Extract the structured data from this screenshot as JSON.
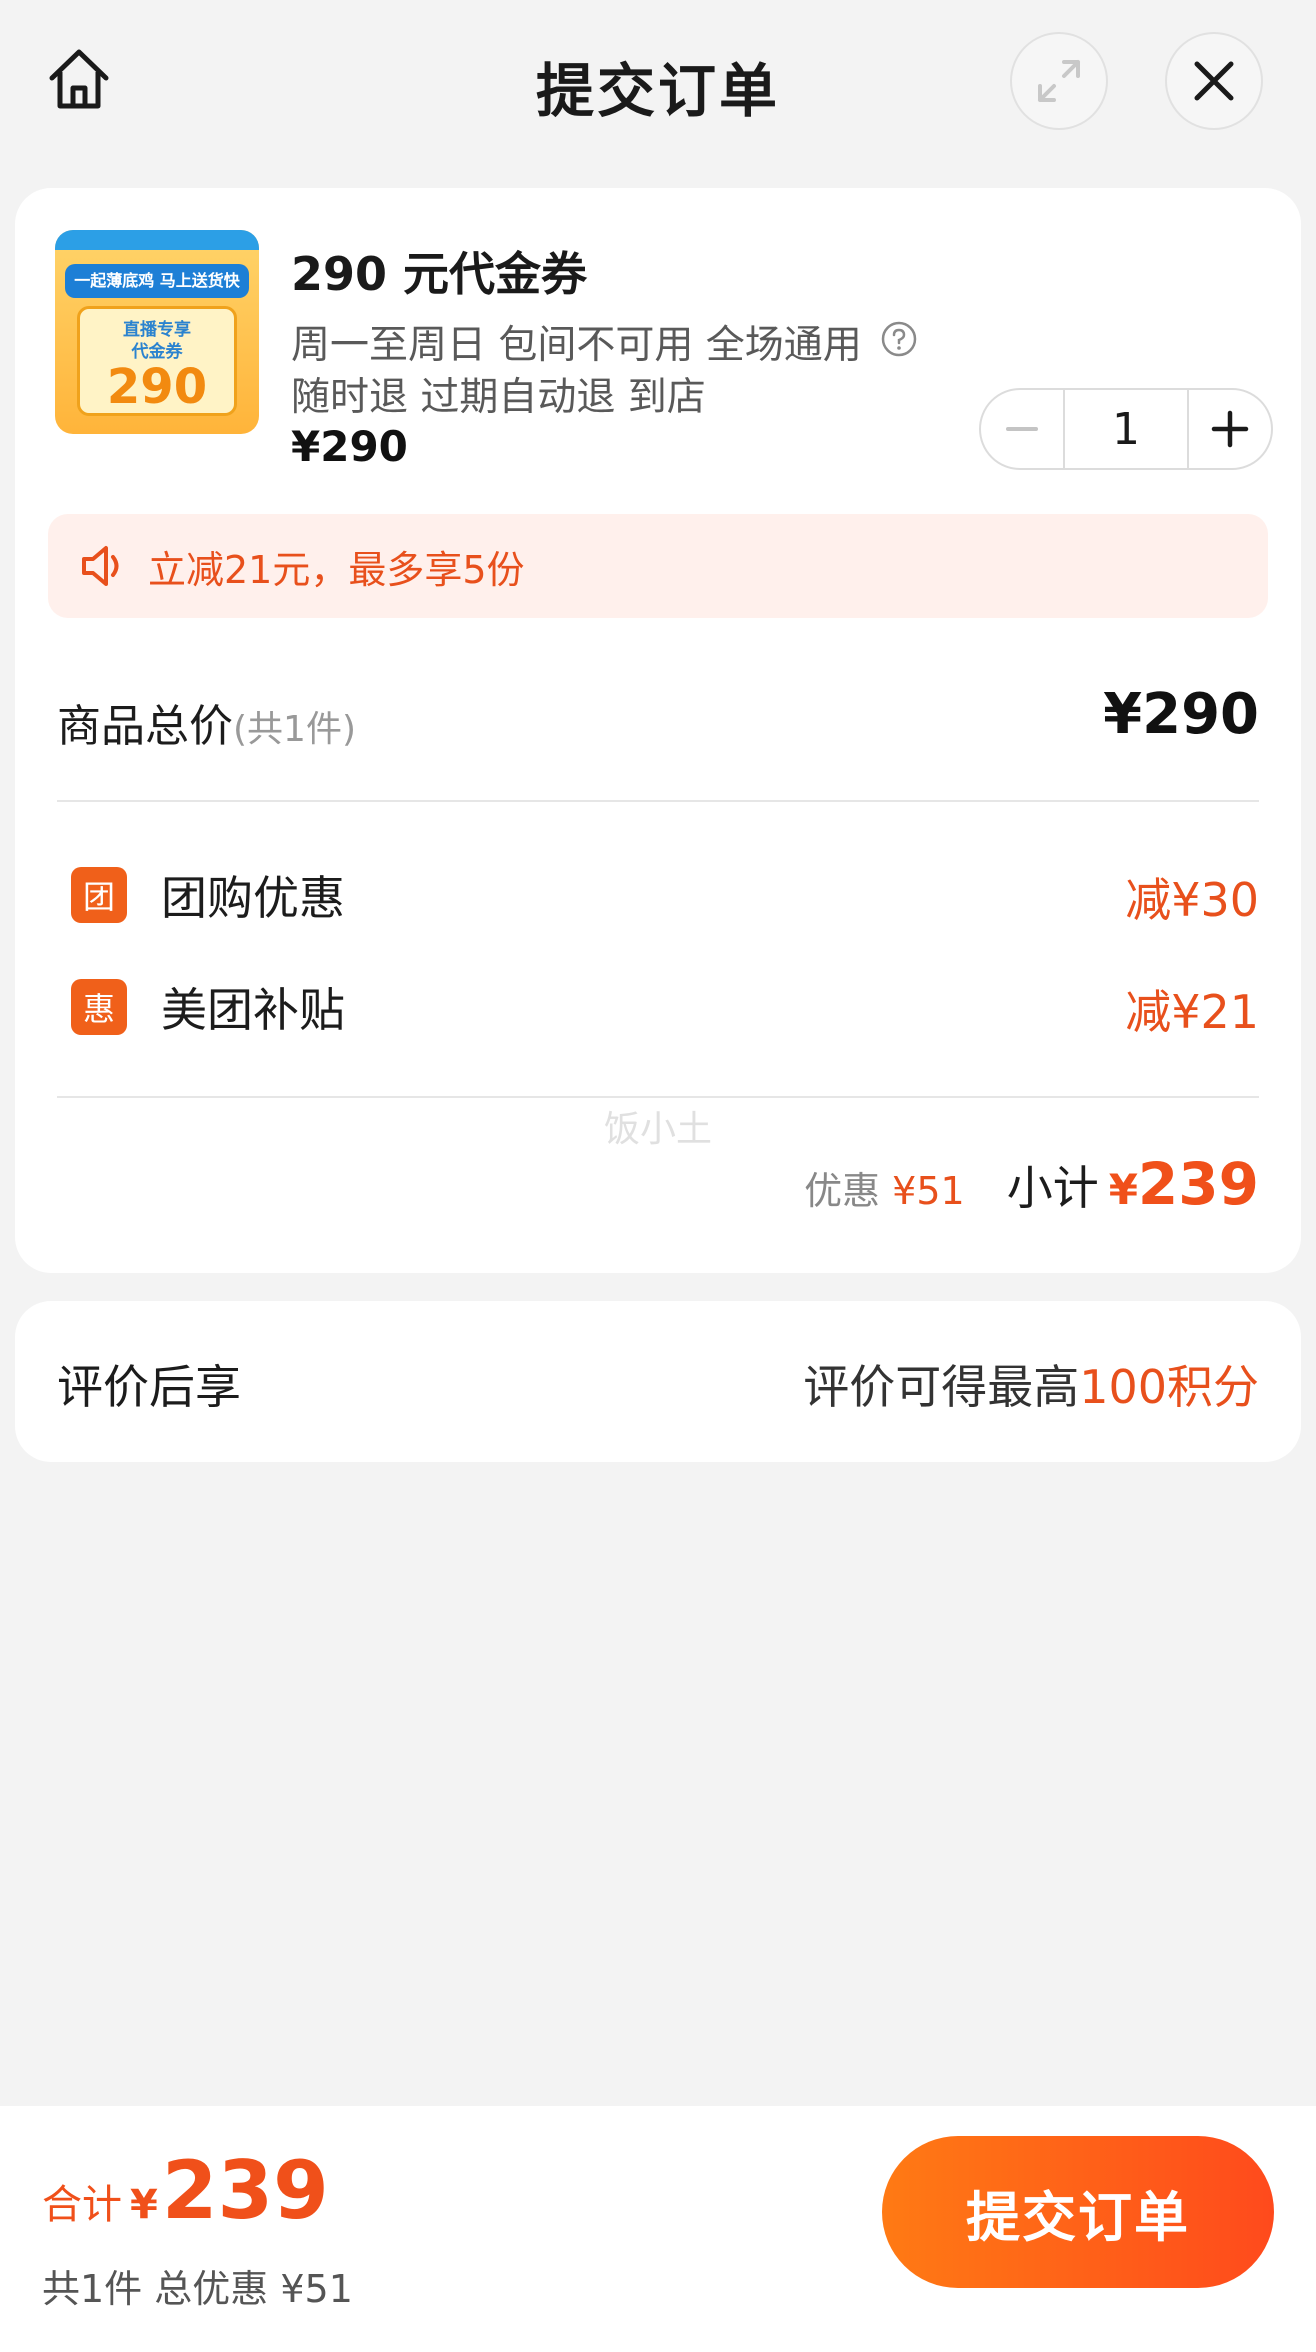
{
  "header": {
    "title": "提交订单",
    "home_icon": "home-icon",
    "expand_icon": "expand-icon",
    "close_icon": "close-icon"
  },
  "product": {
    "thumb": {
      "banner": "一起薄底鸡 马上送货快",
      "small_line1": "直播专享",
      "small_line2": "代金券",
      "amount": "290"
    },
    "title": "290 元代金券",
    "desc_line1": "周一至周日 包间不可用 全场通用",
    "desc_line2": "随时退 过期自动退 到店",
    "price": "¥290",
    "quantity": "1"
  },
  "promo": {
    "text": "立减21元，最多享5份",
    "icon": "speaker-icon"
  },
  "summary": {
    "total_label": "商品总价",
    "total_sub": "(共1件)",
    "total_value": "¥290",
    "discounts": [
      {
        "badge": "团",
        "label": "团购优惠",
        "value": "减¥30"
      },
      {
        "badge": "惠",
        "label": "美团补贴",
        "value": "减¥21"
      }
    ],
    "watermark": "饭小土",
    "discount_label": "优惠",
    "discount_value": "¥51",
    "subtotal_label": "小计",
    "subtotal_currency": "¥",
    "subtotal_value": "239"
  },
  "review": {
    "label": "评价后享",
    "value_prefix": "评价可得最高",
    "value_highlight": "100积分"
  },
  "bottom_bar": {
    "total_label": "合计",
    "currency": "¥",
    "total_value": "239",
    "meta": "共1件 总优惠 ¥51",
    "submit_label": "提交订单"
  },
  "colors": {
    "accent": "#f0501a",
    "promo_bg": "#fff0ec",
    "page_bg": "#f3f3f3"
  }
}
